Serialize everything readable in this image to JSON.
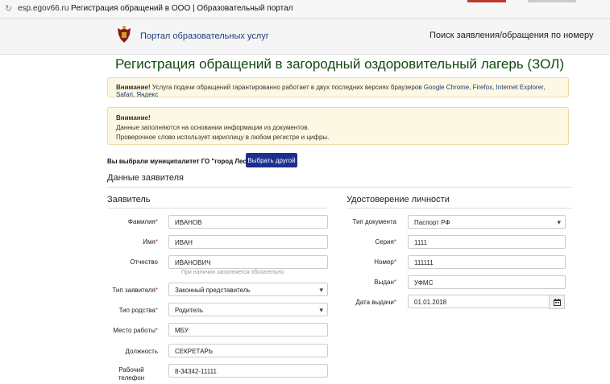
{
  "browser": {
    "domain": "esp.egov66.ru",
    "page_title": "Регистрация обращений в ООО | Образовательный портал"
  },
  "header": {
    "portal_link": "Портал образовательных услуг",
    "search_link": "Поиск заявления/обращения по номеру"
  },
  "page": {
    "title": "Регистрация обращений в загородный оздоровительный лагерь (ЗОЛ)"
  },
  "alert1": {
    "strong": "Внимание!",
    "text": "Услуга подачи обращений гарантированно работает в двух последних версиях браузеров",
    "browsers": [
      "Google Chrome",
      "Firefox",
      "Internet Explorer",
      "Safari",
      "Яндекс"
    ]
  },
  "alert2": {
    "strong": "Внимание!",
    "line1": "Данные заполняются на основании информации из документов.",
    "line2": "Проверочное слово использует кириллицу в любом регистре и цифры."
  },
  "municipality": {
    "text": "Вы выбрали муниципалитет ГО \"город Лесной\"",
    "button": "Выбрать другой"
  },
  "section_title": "Данные заявителя",
  "applicant": {
    "title": "Заявитель",
    "surname_label": "Фамилия",
    "surname": "ИВАНОВ",
    "name_label": "Имя",
    "name": "ИВАН",
    "patronymic_label": "Отчество",
    "patronymic": "ИВАНОВИЧ",
    "patronymic_hint": "При наличии заполняется обязательно",
    "type_label": "Тип заявителя",
    "type": "Законный представитель",
    "kinship_label": "Тип родства",
    "kinship": "Родитель",
    "work_label": "Место работы",
    "work": "МБУ",
    "position_label": "Должность",
    "position": "СЕКРЕТАРЬ",
    "phone_label_1": "Рабочий",
    "phone_label_2": "телефон",
    "phone": "8-34342-11111"
  },
  "identity": {
    "title": "Удостоверение личности",
    "doc_type_label": "Тип документа",
    "doc_type": "Паспорт РФ",
    "series_label": "Серия",
    "series": "1111",
    "number_label": "Номер",
    "number": "111111",
    "issued_by_label": "Выдан",
    "issued_by": "УФМС",
    "issue_date_label": "Дата выдачи",
    "issue_date": "01.01.2018"
  },
  "icons": {
    "emblem": "coat-of-arms-icon",
    "calendar": "calendar-icon",
    "reload": "reload-icon"
  }
}
